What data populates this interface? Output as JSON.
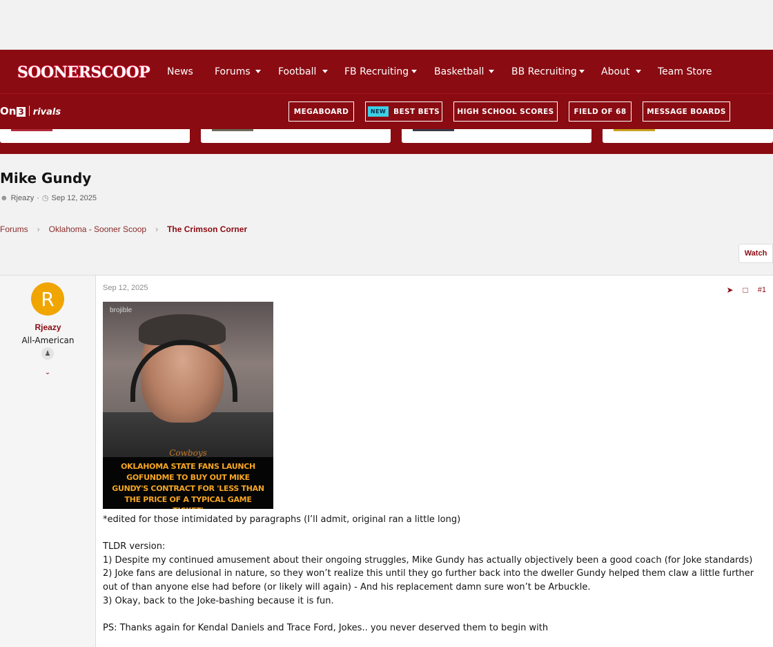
{
  "site": {
    "logo_text": "SOONERSCOOP",
    "nav": [
      {
        "label": "News",
        "caret": false
      },
      {
        "label": "Forums",
        "caret": true
      },
      {
        "label": "Football",
        "caret": true
      },
      {
        "label": "FB Recruiting",
        "caret": true
      },
      {
        "label": "Basketball",
        "caret": true
      },
      {
        "label": "BB Recruiting",
        "caret": true
      },
      {
        "label": "About",
        "caret": true
      },
      {
        "label": "Team Store",
        "caret": false
      }
    ]
  },
  "subbar": {
    "brand_on3": "On",
    "brand_on3_box": "3",
    "brand_rivals": "rivals",
    "new_badge": "NEW",
    "links": [
      "MEGABOARD",
      "BEST BETS",
      "HIGH SCHOOL SCORES",
      "FIELD OF 68",
      "MESSAGE BOARDS"
    ]
  },
  "thread": {
    "title": "Mike Gundy",
    "author": "Rjeazy",
    "date": "Sep 12, 2025",
    "watch_label": "Watch"
  },
  "breadcrumb": [
    "Forums",
    "Oklahoma - Sooner Scoop",
    "The Crimson Corner"
  ],
  "post": {
    "avatar_letter": "R",
    "username": "Rjeazy",
    "user_title": "All-American",
    "date": "Sep 12, 2025",
    "number": "#1",
    "image": {
      "watermark": "brojible",
      "logo": "Cowboys",
      "caption": "OKLAHOMA STATE FANS LAUNCH GOFUNDME TO BUY OUT MIKE GUNDY'S CONTRACT FOR 'LESS THAN THE PRICE OF A TYPICAL GAME TICKET'"
    },
    "body": {
      "line1": "*edited for those intimidated by paragraphs (I’ll admit, original ran a little long)",
      "line2": "TLDR version:",
      "line3": "1) Despite my continued amusement about their ongoing struggles, Mike Gundy has actually objectively been a good coach (for Joke standards)",
      "line4": "2) Joke fans are delusional in nature, so they won’t realize this until they go further back into the dweller Gundy helped them claw a little further out of than anyone else had before (or likely will again) - And his replacement damn sure won’t be Arbuckle.",
      "line5": "3) Okay, back to the Joke-bashing because it is fun.",
      "line6": "PS: Thanks again for Kendal Daniels and Trace Ford, Jokes.. you never deserved them to begin with"
    }
  },
  "colors": {
    "brand": "#8a0b12",
    "avatar": "#f0a500",
    "new_badge": "#3bd0e6"
  }
}
